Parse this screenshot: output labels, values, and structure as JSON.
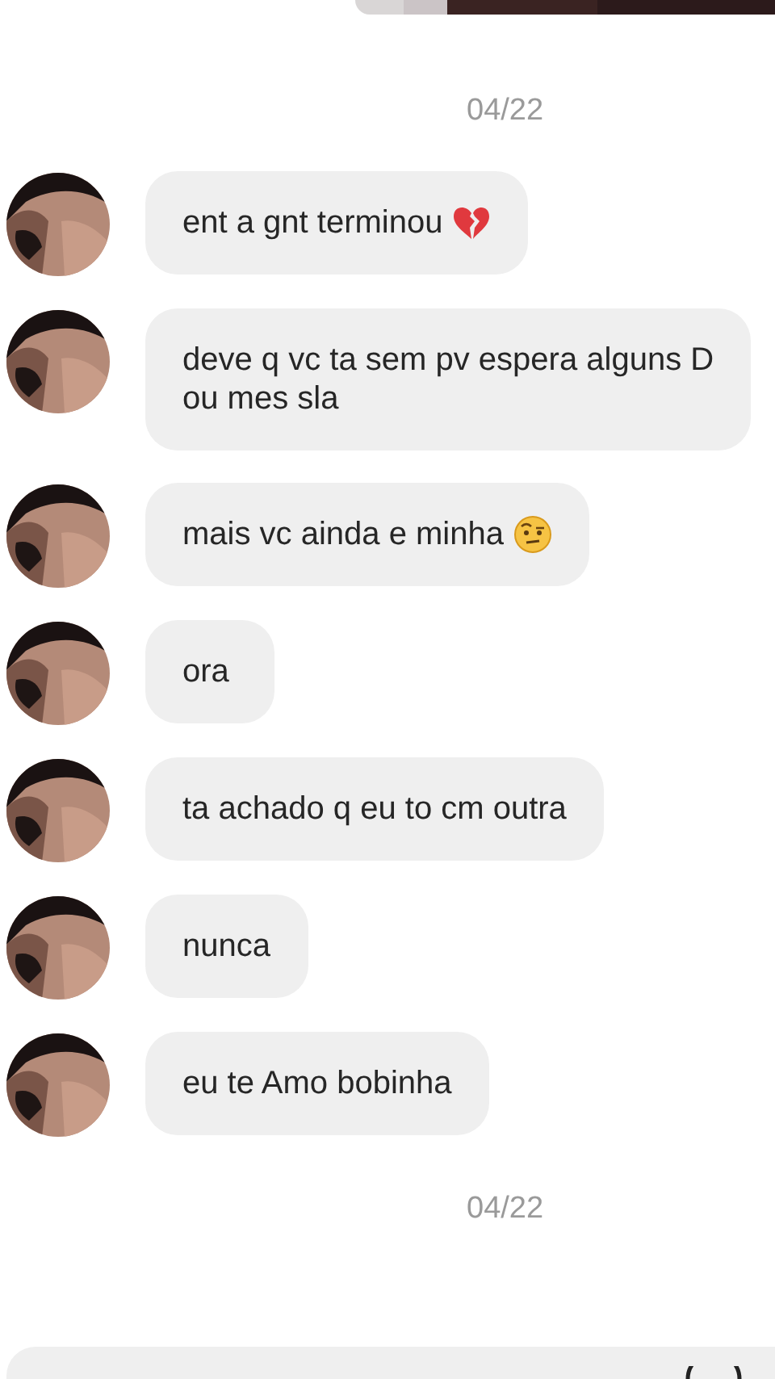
{
  "date_top": "04/22",
  "messages": [
    {
      "kind": "heartbreak",
      "text": "ent a gnt terminou"
    },
    {
      "kind": "plain",
      "text": "deve q vc ta sem pv espera alguns D\nou mes sla"
    },
    {
      "kind": "skeptical",
      "text": "mais vc ainda e minha"
    },
    {
      "kind": "plain",
      "text": "ora"
    },
    {
      "kind": "plain",
      "text": "ta achado q eu to cm outra"
    },
    {
      "kind": "plain",
      "text": "nunca"
    },
    {
      "kind": "plain",
      "text": "eu te Amo bobinha"
    }
  ],
  "date_bottom": "04/22",
  "composer": {
    "kind": "field"
  }
}
